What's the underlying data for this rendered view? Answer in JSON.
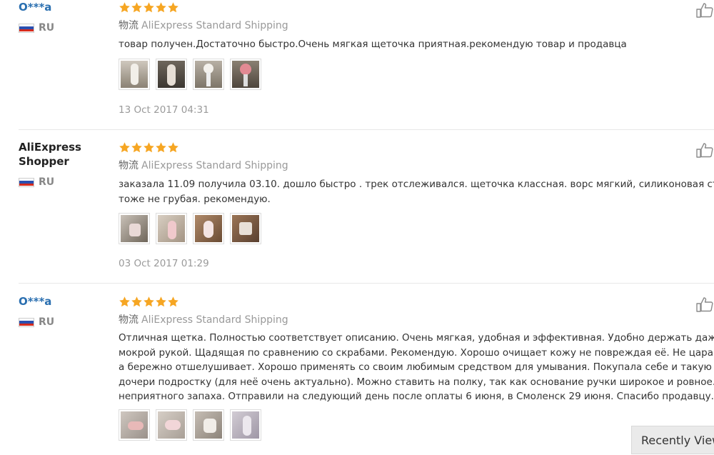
{
  "reviews": [
    {
      "user": "O***a",
      "country": "RU",
      "rating": 5,
      "shipping_cn": "物流",
      "shipping": "AliExpress Standard Shipping",
      "text_lines": [
        "товар получен.Достаточно быстро.Очень мягкая щеточка приятная.рекомендую товар и продавца"
      ],
      "photo_count": 4,
      "date": "13 Oct 2017 04:31"
    },
    {
      "user": "AliExpress Shopper",
      "country": "RU",
      "rating": 5,
      "shipping_cn": "物流",
      "shipping": "AliExpress Standard Shipping",
      "text_lines": [
        "заказала 11.09 получила 03.10. дошло быстро . трек отслеживался. щеточка классная. ворс мягкий, силиконовая сторон",
        "тоже не грубая. рекомендую."
      ],
      "photo_count": 4,
      "date": "03 Oct 2017 01:29"
    },
    {
      "user": "O***a",
      "country": "RU",
      "rating": 5,
      "shipping_cn": "物流",
      "shipping": "AliExpress Standard Shipping",
      "text_lines": [
        "Отличная щетка. Полностью соответствует описанию. Очень мягкая, удобная и эффективная. Удобно держать даже",
        "мокрой рукой. Щадящая по сравнению со скрабами. Рекомендую. Хорошо очищает кожу не повреждая её. Не царапае",
        "а бережно отшелушивает. Хорошо применять со своим любимым средством для умывания. Покупала себе и такую же",
        "дочери подростку (для неё очень актуально). Можно ставить на полку, так как основание ручки широкое и ровное. Нет",
        "неприятного запаха. Отправили на следующий день после оплаты 6 июня, в Смоленск 29 июня. Спасибо продавцу."
      ],
      "photo_count": 4
    }
  ],
  "recently_viewed": "Recently View",
  "icons": {
    "like": "thumbs-up-icon",
    "star": "star-icon",
    "flag": "russia-flag-icon"
  },
  "colors": {
    "star": "#f6a623",
    "user_link": "#2a6fb0",
    "meta": "#999999"
  }
}
